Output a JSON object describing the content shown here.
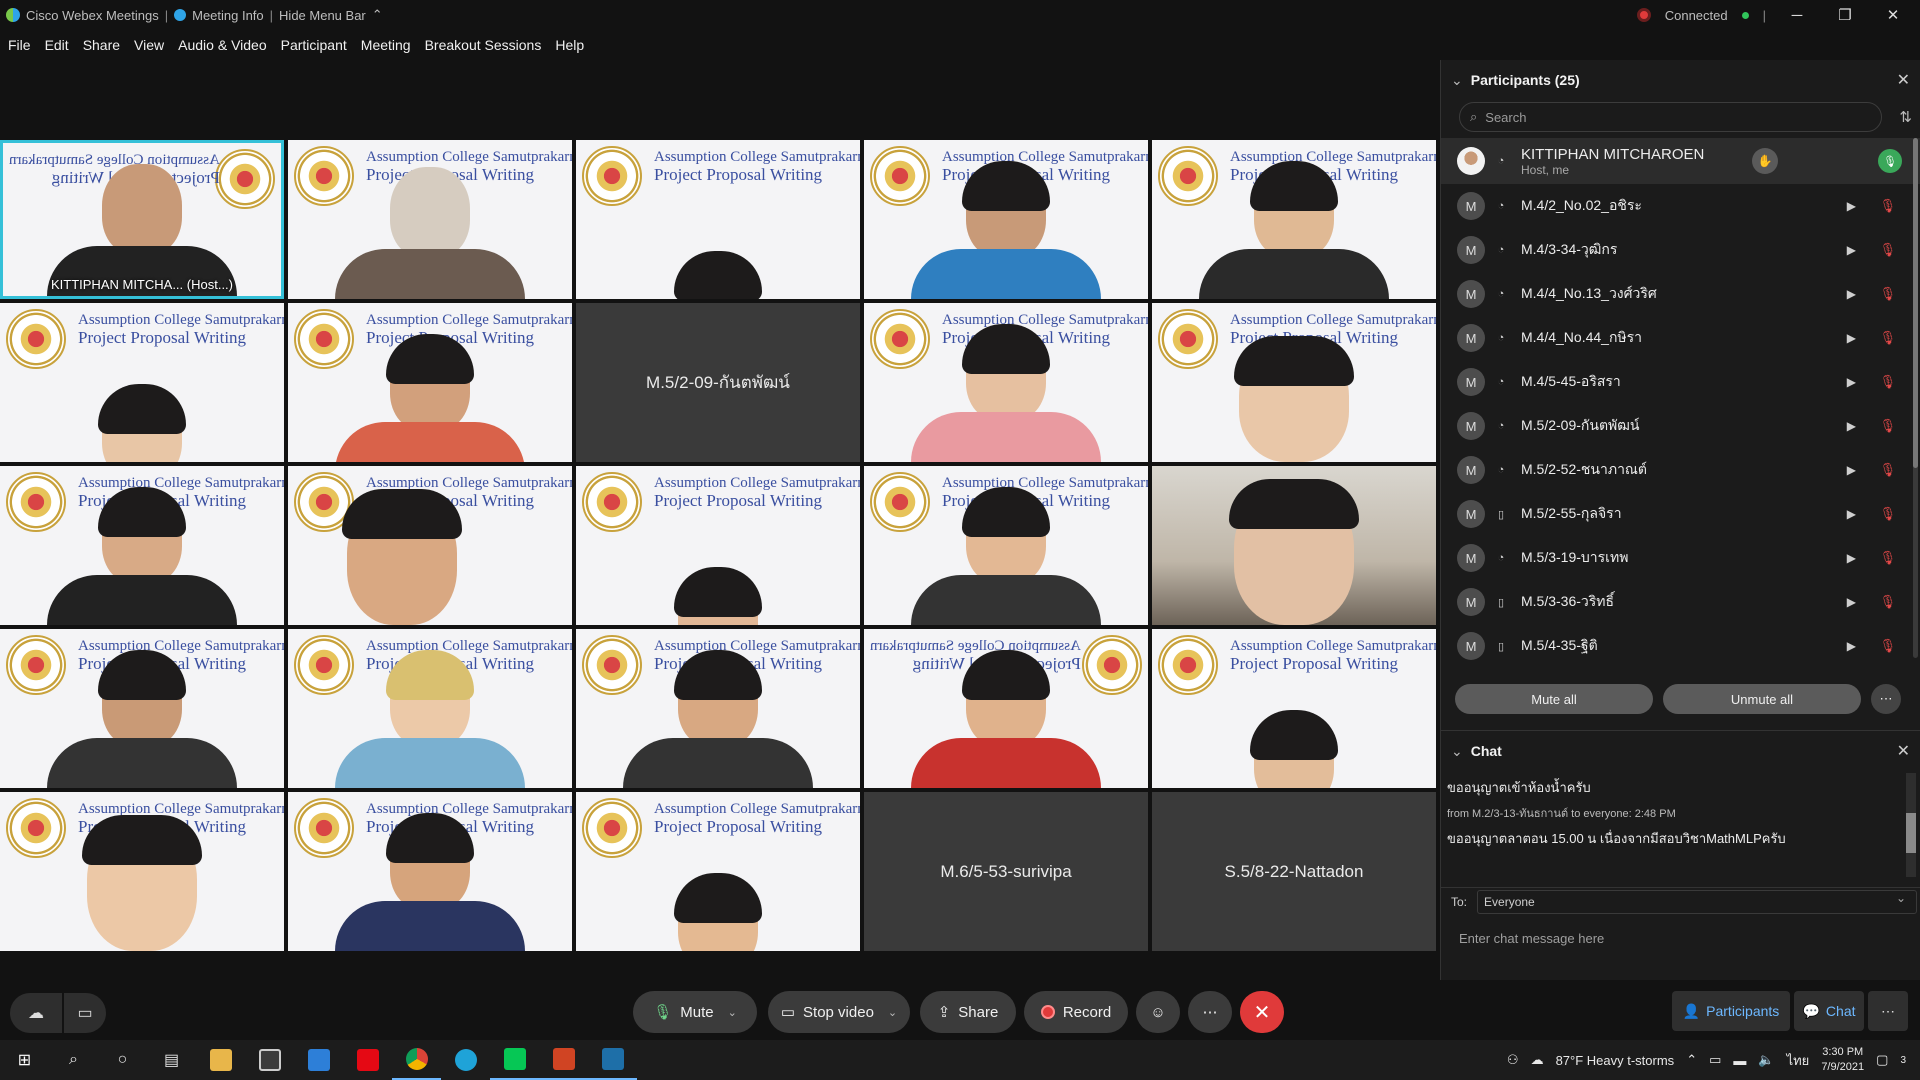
{
  "titlebar": {
    "app_name": "Cisco Webex Meetings",
    "meeting_info": "Meeting Info",
    "hide_menu": "Hide Menu Bar",
    "status": "Connected"
  },
  "menu": [
    "File",
    "Edit",
    "Share",
    "View",
    "Audio & Video",
    "Participant",
    "Meeting",
    "Breakout Sessions",
    "Help"
  ],
  "virtual_background": {
    "line1": "Assumption College Samutprakarn",
    "line2": "Project Proposal Writing"
  },
  "tiles": {
    "host_label": "KITTIPHAN MITCHA... (Host...)",
    "name_tile_1": "M.5/2-09-กันตพัฒน์",
    "name_tile_2": "M.6/5-53-surivipa",
    "name_tile_3": "S.5/8-22-Nattadon"
  },
  "participants_panel": {
    "title": "Participants (25)",
    "search_placeholder": "Search",
    "me": {
      "name": "KITTIPHAN MITCHAROEN",
      "role": "Host, me"
    },
    "list": [
      {
        "initial": "M",
        "name": "M.4/2_No.02_อชิระ"
      },
      {
        "initial": "M",
        "name": "M.4/3-34-วุฒิกร"
      },
      {
        "initial": "M",
        "name": "M.4/4_No.13_วงศ์วริศ"
      },
      {
        "initial": "M",
        "name": "M.4/4_No.44_กษิรา"
      },
      {
        "initial": "M",
        "name": "M.4/5-45-อริสรา"
      },
      {
        "initial": "M",
        "name": "M.5/2-09-กันตพัฒน์"
      },
      {
        "initial": "M",
        "name": "M.5/2-52-ชนาภาณต์"
      },
      {
        "initial": "M",
        "name": "M.5/2-55-กุลจิรา"
      },
      {
        "initial": "M",
        "name": "M.5/3-19-บารเทพ"
      },
      {
        "initial": "M",
        "name": "M.5/3-36-วริทธิ์"
      },
      {
        "initial": "M",
        "name": "M.5/4-35-ฐิติ"
      }
    ],
    "mute_all": "Mute all",
    "unmute_all": "Unmute all"
  },
  "chat_panel": {
    "title": "Chat",
    "message1": "ขออนุญาตเข้าห้องน้ำครับ",
    "from_line": "from M.2/3-13-ทันธกานต์ to everyone:   2:48 PM",
    "message2": "ขออนุญาตลาตอน 15.00 น เนื่องจากมีสอบวิชาMathMLPครับ",
    "to_label": "To:",
    "to_value": "Everyone",
    "input_placeholder": "Enter chat message here"
  },
  "controls": {
    "mute": "Mute",
    "stop_video": "Stop video",
    "share": "Share",
    "record": "Record",
    "participants": "Participants",
    "chat": "Chat"
  },
  "taskbar": {
    "weather": "87°F  Heavy t-storms",
    "lang": "ไทย",
    "time": "3:30 PM",
    "date": "7/9/2021",
    "notif_count": "3"
  }
}
